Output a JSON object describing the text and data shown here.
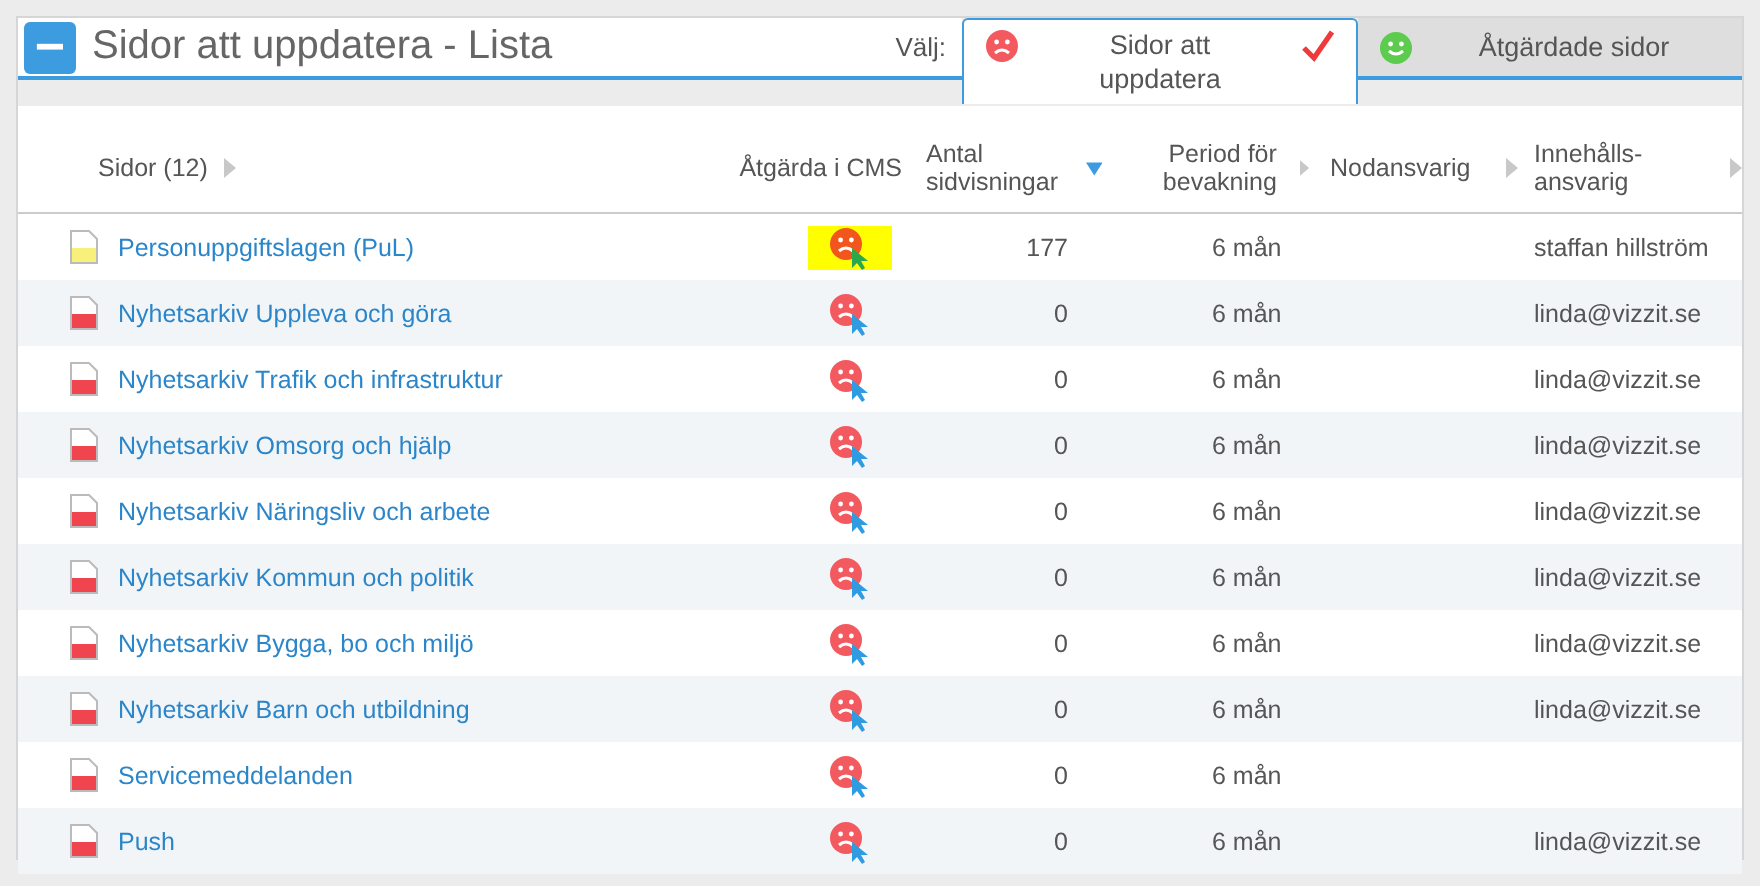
{
  "header": {
    "collapse_icon": "−",
    "title": "Sidor att uppdatera - Lista",
    "choose_label": "Välj:"
  },
  "tabs": [
    {
      "label": "Sidor att uppdatera",
      "kind": "sad",
      "selected": true
    },
    {
      "label": "Åtgärdade sidor",
      "kind": "happy",
      "selected": false
    }
  ],
  "table": {
    "columns": [
      {
        "label": "Sidor (12)",
        "sorted": false
      },
      {
        "label": "Åtgärda i CMS"
      },
      {
        "label": "Antal sidvisningar",
        "sorted": true
      },
      {
        "label": "Period för bevakning",
        "sorted": false
      },
      {
        "label": "Nodansvarig",
        "sorted": false
      },
      {
        "label": "Innehålls-ansvarig",
        "sorted": false
      }
    ],
    "rows": [
      {
        "name": "Personuppgiftslagen (PuL)",
        "color": "#f7f07a",
        "highlighted": true,
        "views": "177",
        "period": "6 mån",
        "content_owner": "staffan hillström"
      },
      {
        "name": "Nyhetsarkiv Uppleva och göra",
        "color": "#f0454f",
        "highlighted": false,
        "views": "0",
        "period": "6 mån",
        "content_owner": "linda@vizzit.se"
      },
      {
        "name": "Nyhetsarkiv Trafik och infrastruktur",
        "color": "#f0454f",
        "highlighted": false,
        "views": "0",
        "period": "6 mån",
        "content_owner": "linda@vizzit.se"
      },
      {
        "name": "Nyhetsarkiv Omsorg och hjälp",
        "color": "#f0454f",
        "highlighted": false,
        "views": "0",
        "period": "6 mån",
        "content_owner": "linda@vizzit.se"
      },
      {
        "name": "Nyhetsarkiv Näringsliv och arbete",
        "color": "#f0454f",
        "highlighted": false,
        "views": "0",
        "period": "6 mån",
        "content_owner": "linda@vizzit.se"
      },
      {
        "name": "Nyhetsarkiv Kommun och politik",
        "color": "#f0454f",
        "highlighted": false,
        "views": "0",
        "period": "6 mån",
        "content_owner": "linda@vizzit.se"
      },
      {
        "name": "Nyhetsarkiv Bygga, bo och miljö",
        "color": "#f0454f",
        "highlighted": false,
        "views": "0",
        "period": "6 mån",
        "content_owner": "linda@vizzit.se"
      },
      {
        "name": "Nyhetsarkiv Barn och utbildning",
        "color": "#f0454f",
        "highlighted": false,
        "views": "0",
        "period": "6 mån",
        "content_owner": "linda@vizzit.se"
      },
      {
        "name": "Servicemeddelanden",
        "color": "#f0454f",
        "highlighted": false,
        "views": "0",
        "period": "6 mån"
      },
      {
        "name": "Push",
        "color": "#f0454f",
        "highlighted": false,
        "views": "0",
        "period": "6 mån",
        "content_owner": "linda@vizzit.se"
      }
    ]
  }
}
